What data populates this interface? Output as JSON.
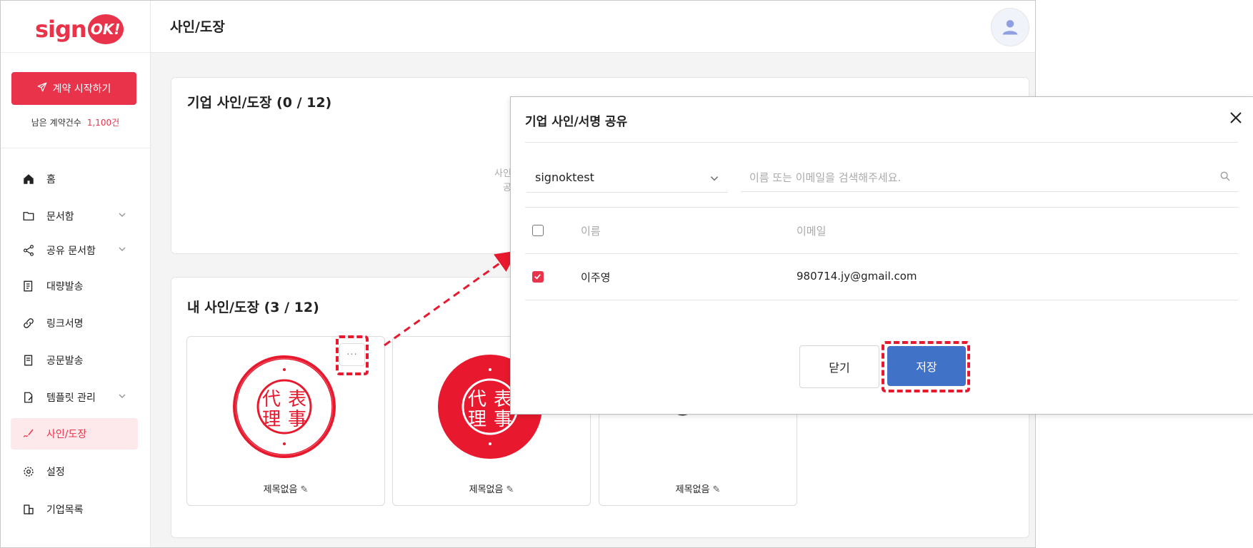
{
  "brand": {
    "logo_text": "sign",
    "logo_badge": "OK!"
  },
  "sidebar": {
    "start_button": "계약 시작하기",
    "remaining_label": "남은 계약건수",
    "remaining_count": "1,100건",
    "items": [
      {
        "label": "홈",
        "icon": "home-icon"
      },
      {
        "label": "문서함",
        "icon": "folder-icon"
      },
      {
        "label": "공유 문서함",
        "icon": "share-icon"
      },
      {
        "label": "대량발송",
        "icon": "bulk-send-icon"
      },
      {
        "label": "링크서명",
        "icon": "link-icon"
      },
      {
        "label": "공문발송",
        "icon": "document-icon"
      },
      {
        "label": "템플릿 관리",
        "icon": "template-icon"
      },
      {
        "label": "사인/도장",
        "icon": "signature-icon"
      },
      {
        "label": "설정",
        "icon": "gear-icon"
      },
      {
        "label": "기업목록",
        "icon": "building-icon"
      }
    ]
  },
  "header": {
    "title": "사인/도장"
  },
  "company_section": {
    "title": "기업 사인/도장 (0 / 12)",
    "placeholder_line1": "사인",
    "placeholder_line2": "공"
  },
  "my_section": {
    "title": "내 사인/도장 (3 / 12)",
    "cards": [
      {
        "label": "제목없음",
        "stamp_text": [
          "代",
          "表",
          "理",
          "事"
        ]
      },
      {
        "label": "제목없음",
        "stamp_text": [
          "代",
          "表",
          "理",
          "事"
        ]
      },
      {
        "label": "제목없음"
      }
    ],
    "more_button": "···"
  },
  "modal": {
    "title": "기업 사인/서명 공유",
    "select_value": "signoktest",
    "search_placeholder": "이름 또는 이메일을 검색해주세요.",
    "columns": {
      "name": "이름",
      "email": "이메일"
    },
    "rows": [
      {
        "name": "이주영",
        "email": "980714.jy@gmail.com",
        "checked": true
      }
    ],
    "close_button": "닫기",
    "save_button": "저장"
  },
  "colors": {
    "brand_red": "#e8334a",
    "save_blue": "#4072c8",
    "highlight_red": "#e8192e"
  }
}
